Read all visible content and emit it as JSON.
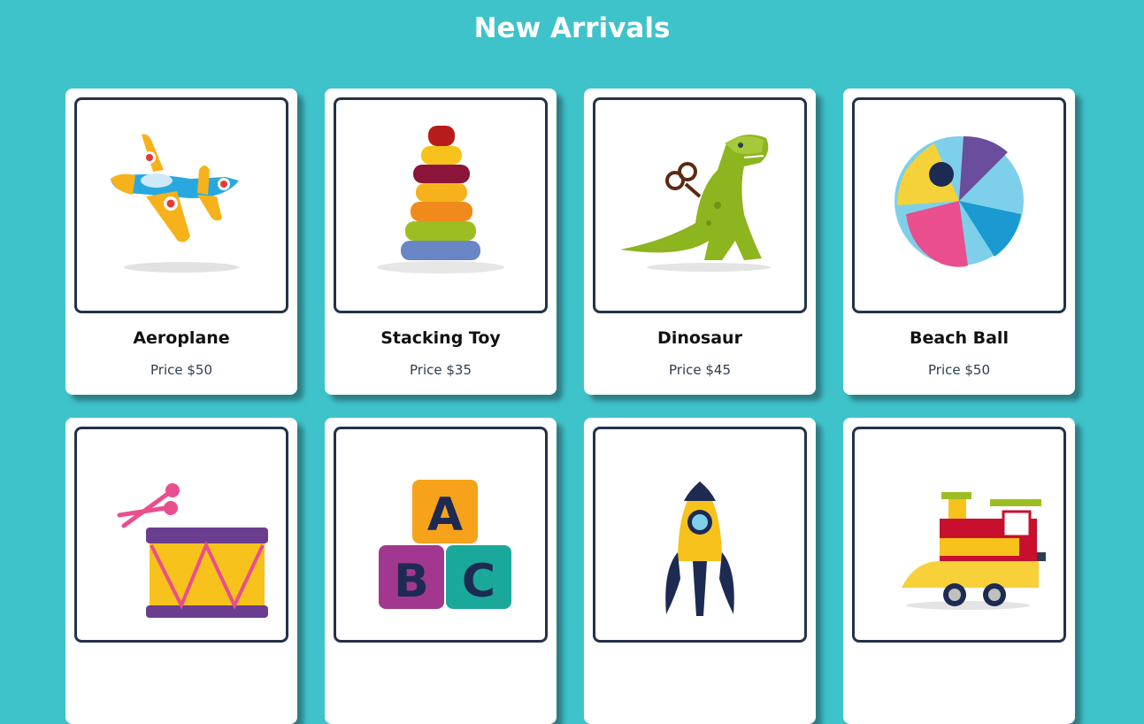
{
  "page": {
    "title": "New Arrivals"
  },
  "products": [
    {
      "name": "Aeroplane",
      "price": "Price $50",
      "icon": "aeroplane-icon"
    },
    {
      "name": "Stacking Toy",
      "price": "Price $35",
      "icon": "stacking-rings-icon"
    },
    {
      "name": "Dinosaur",
      "price": "Price $45",
      "icon": "dinosaur-icon"
    },
    {
      "name": "Beach Ball",
      "price": "Price $50",
      "icon": "beach-ball-icon"
    },
    {
      "name": "",
      "price": "",
      "icon": "drum-icon"
    },
    {
      "name": "",
      "price": "",
      "icon": "abc-blocks-icon"
    },
    {
      "name": "",
      "price": "",
      "icon": "rocket-icon"
    },
    {
      "name": "",
      "price": "",
      "icon": "toy-train-icon"
    }
  ],
  "colors": {
    "background": "#3fc3cb",
    "card": "#ffffff",
    "frame_border": "#24324a"
  }
}
